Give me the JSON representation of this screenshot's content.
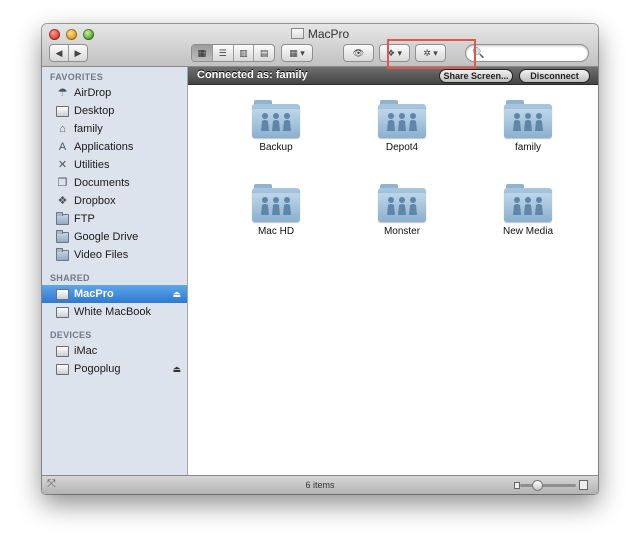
{
  "window": {
    "title": "MacPro"
  },
  "toolbar": {
    "back_glyph": "◀",
    "forward_glyph": "▶",
    "view_icon_glyph": "▦",
    "view_list_glyph": "☰",
    "view_columns_glyph": "▥",
    "view_coverflow_glyph": "▤",
    "arrange_glyph": "▦ ▾",
    "quicklook_glyph": "👁",
    "dropbox_glyph": "❖ ▾",
    "action_glyph": "✲ ▾",
    "search": {
      "glyph": "🔍",
      "placeholder": "",
      "value": ""
    }
  },
  "sidebar": {
    "sections": [
      {
        "heading": "FAVORITES",
        "items": [
          {
            "label": "AirDrop",
            "icon": "airdrop-icon",
            "glyph": "☂"
          },
          {
            "label": "Desktop",
            "icon": "desktop-icon",
            "glyph": ""
          },
          {
            "label": "family",
            "icon": "home-icon",
            "glyph": "⌂"
          },
          {
            "label": "Applications",
            "icon": "applications-icon",
            "glyph": "A"
          },
          {
            "label": "Utilities",
            "icon": "utilities-icon",
            "glyph": "✕"
          },
          {
            "label": "Documents",
            "icon": "documents-icon",
            "glyph": "❐"
          },
          {
            "label": "Dropbox",
            "icon": "dropbox-icon",
            "glyph": "❖"
          },
          {
            "label": "FTP",
            "icon": "folder-icon",
            "glyph": ""
          },
          {
            "label": "Google Drive",
            "icon": "folder-icon",
            "glyph": ""
          },
          {
            "label": "Video Files",
            "icon": "folder-icon",
            "glyph": ""
          }
        ]
      },
      {
        "heading": "SHARED",
        "items": [
          {
            "label": "MacPro",
            "icon": "server-icon",
            "glyph": "",
            "selected": true,
            "eject": "⏏"
          },
          {
            "label": "White MacBook",
            "icon": "laptop-icon",
            "glyph": ""
          }
        ]
      },
      {
        "heading": "DEVICES",
        "items": [
          {
            "label": "iMac",
            "icon": "imac-icon",
            "glyph": ""
          },
          {
            "label": "Pogoplug",
            "icon": "drive-icon",
            "glyph": "",
            "eject": "⏏"
          }
        ]
      }
    ]
  },
  "connection": {
    "label": "Connected as: family",
    "share_screen_label": "Share Screen...",
    "disconnect_label": "Disconnect"
  },
  "shares": [
    {
      "name": "Backup"
    },
    {
      "name": "Depot4"
    },
    {
      "name": "family"
    },
    {
      "name": "Mac HD"
    },
    {
      "name": "Monster"
    },
    {
      "name": "New Media"
    }
  ],
  "status": {
    "count": "6 items",
    "sidebar_toggle_glyph": "⤧",
    "icon_size": 0.3
  },
  "colors": {
    "highlight": "#e0574d",
    "selection": "#3e88d8",
    "sidebar": "#dce3ec"
  }
}
